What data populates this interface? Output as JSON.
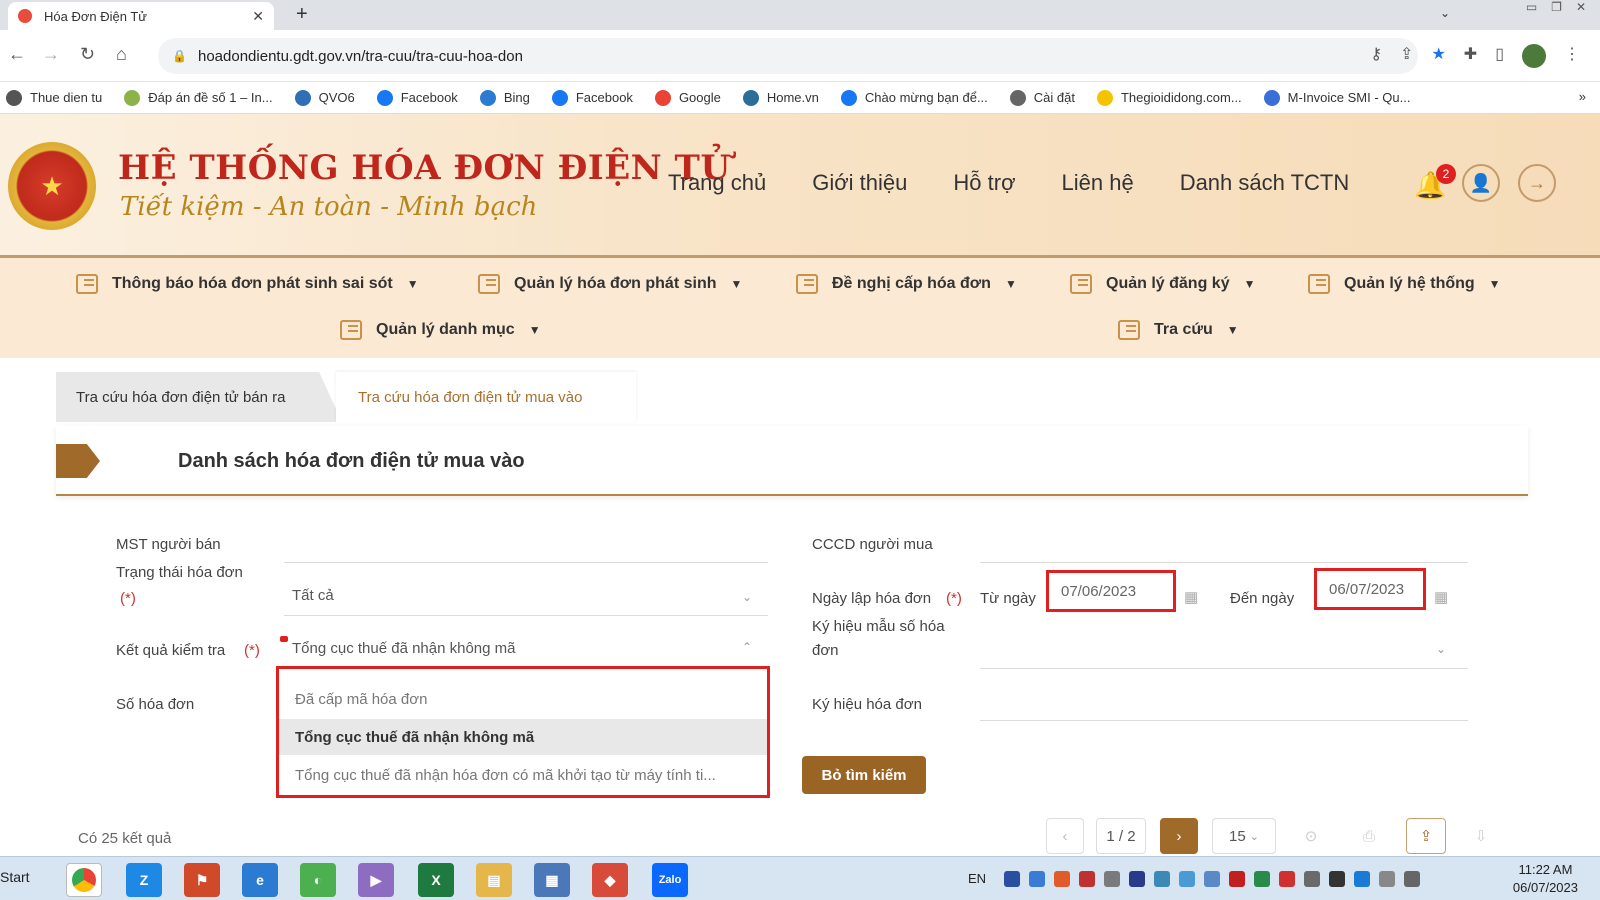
{
  "browser": {
    "tab_title": "Hóa Đơn Điện Tử",
    "url": "hoadondientu.gdt.gov.vn/tra-cuu/tra-cuu-hoa-don",
    "bookmarks": [
      {
        "label": "Thue dien tu",
        "color": "#555555"
      },
      {
        "label": "Đáp án đề số 1 – In...",
        "color": "#8bb34a"
      },
      {
        "label": "QVO6",
        "color": "#2f6fb5"
      },
      {
        "label": "Facebook",
        "color": "#1877f2"
      },
      {
        "label": "Bing",
        "color": "#2b7bd3"
      },
      {
        "label": "Facebook",
        "color": "#1877f2"
      },
      {
        "label": "Google",
        "color": "#ea4335"
      },
      {
        "label": "Home.vn",
        "color": "#2a6e9a"
      },
      {
        "label": "Chào mừng bạn để...",
        "color": "#1877f2"
      },
      {
        "label": "Cài đặt",
        "color": "#666666"
      },
      {
        "label": "Thegioididong.com...",
        "color": "#f5c400"
      },
      {
        "label": "M-Invoice SMI - Qu...",
        "color": "#3a6fd8"
      }
    ]
  },
  "site": {
    "title": "HỆ THỐNG HÓA ĐƠN ĐIỆN TỬ",
    "slogan": "Tiết kiệm - An toàn - Minh bạch",
    "nav": [
      "Trang chủ",
      "Giới thiệu",
      "Hỗ trợ",
      "Liên hệ",
      "Danh sách TCTN"
    ],
    "notification_count": "2",
    "menu": [
      "Thông báo hóa đơn phát sinh sai sót",
      "Quản lý hóa đơn phát sinh",
      "Đề nghị cấp hóa đơn",
      "Quản lý đăng ký",
      "Quản lý hệ thống",
      "Quản lý danh mục",
      "Tra cứu"
    ]
  },
  "tabs": {
    "sold": "Tra cứu hóa đơn điện tử bán ra",
    "bought": "Tra cứu hóa đơn điện tử mua vào"
  },
  "section": {
    "title": "Danh sách hóa đơn điện tử mua vào"
  },
  "form": {
    "seller_tax_label": "MST người bán",
    "status_label": "Trạng thái hóa đơn",
    "status_value": "Tất cả",
    "required_mark": "(*)",
    "check_result_label": "Kết quả kiểm tra",
    "check_result_value": "Tổng cục thuế đã nhận không mã",
    "invoice_no_label": "Số hóa đơn",
    "buyer_id_label": "CCCD người mua",
    "date_label": "Ngày lập hóa đơn",
    "from_label": "Từ ngày",
    "from_value": "07/06/2023",
    "to_label": "Đến ngày",
    "to_value": "06/07/2023",
    "template_label_1": "Ký hiệu mẫu số hóa",
    "template_label_2": "đơn",
    "symbol_label": "Ký hiệu hóa đơn",
    "dropdown_options": [
      "Đã cấp mã hóa đơn",
      "Tổng cục thuế đã nhận không mã",
      "Tổng cục thuế đã nhận hóa đơn có mã khởi tạo từ máy tính ti..."
    ],
    "clear_button": "Bỏ tìm kiếm"
  },
  "results": {
    "count_text": "Có 25 kết quả",
    "page": "1 / 2",
    "page_size": "15"
  },
  "taskbar": {
    "start": "Start",
    "lang": "EN",
    "time": "11:22 AM",
    "date": "06/07/2023"
  }
}
